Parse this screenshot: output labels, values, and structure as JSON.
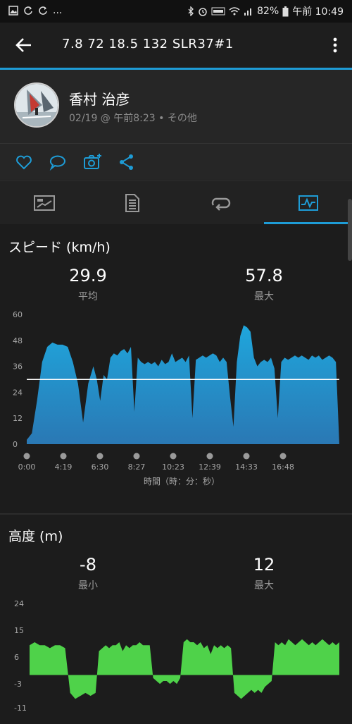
{
  "status_bar": {
    "battery": "82%",
    "time": "午前 10:49",
    "left_dots": "..."
  },
  "toolbar": {
    "title": "7.8  72  18.5  132  SLR37#1"
  },
  "profile": {
    "name": "香村 治彦",
    "meta": "02/19 @ 午前8:23 • その他"
  },
  "colors": {
    "accent": "#1e9cd6",
    "speed_fill": "#1fa6dc",
    "elevation_fill": "#4fd24a"
  },
  "speed": {
    "title": "スピード (km/h)",
    "avg_value": "29.9",
    "avg_label": "平均",
    "max_value": "57.8",
    "max_label": "最大",
    "x_axis_label": "時間（時：分：秒）"
  },
  "elevation": {
    "title": "高度 (m)",
    "min_value": "-8",
    "min_label": "最小",
    "max_value": "12",
    "max_label": "最大"
  },
  "chart_data": [
    {
      "type": "area",
      "title": "スピード (km/h)",
      "xlabel": "時間（時：分：秒）",
      "ylabel": "",
      "ylim": [
        0,
        60
      ],
      "yticks": [
        "0",
        "12",
        "24",
        "36",
        "48",
        "60"
      ],
      "xticks": [
        "0:00",
        "4:19",
        "6:30",
        "8:27",
        "10:23",
        "12:39",
        "14:33",
        "16:48"
      ],
      "reference_line": 29.9,
      "x": [
        0,
        0.3,
        0.6,
        0.9,
        1.2,
        1.5,
        1.8,
        2.1,
        2.4,
        2.7,
        3.0,
        3.3,
        3.6,
        3.9,
        4.1,
        4.3,
        4.5,
        4.7,
        4.9,
        5.1,
        5.3,
        5.5,
        5.7,
        5.9,
        6.1,
        6.3,
        6.5,
        6.7,
        6.9,
        7.1,
        7.3,
        7.5,
        7.7,
        7.9,
        8.1,
        8.3,
        8.5,
        8.7,
        8.9,
        9.1,
        9.3,
        9.5,
        9.7,
        9.9,
        10.1,
        10.3,
        10.5,
        10.7,
        10.9,
        11.1,
        11.3,
        11.5,
        11.7,
        11.9,
        12.1,
        12.3,
        12.5,
        12.7,
        12.9,
        13.1,
        13.3,
        13.5,
        13.7,
        13.9,
        14.1,
        14.3,
        14.5,
        14.7,
        14.9,
        15.1,
        15.3,
        15.5,
        15.7,
        15.9,
        16.1,
        16.3,
        16.5,
        16.7,
        16.9,
        17.1,
        17.3,
        17.5,
        17.7,
        17.9,
        18.1,
        18.3
      ],
      "series": [
        {
          "values": [
            2,
            5,
            20,
            38,
            45,
            47,
            46,
            46,
            45,
            38,
            28,
            10,
            28,
            36,
            30,
            20,
            32,
            30,
            40,
            42,
            41,
            43,
            44,
            42,
            45,
            15,
            40,
            38,
            37,
            38,
            37,
            38,
            36,
            39,
            37,
            38,
            42,
            38,
            39,
            40,
            38,
            41,
            12,
            39,
            40,
            41,
            40,
            41,
            42,
            41,
            38,
            40,
            38,
            22,
            8,
            38,
            50,
            55,
            54,
            52,
            40,
            36,
            38,
            39,
            38,
            40,
            35,
            12,
            38,
            40,
            39,
            40,
            41,
            40,
            41,
            40,
            39,
            41,
            40,
            41,
            39,
            40,
            41,
            40,
            38,
            0
          ]
        }
      ]
    },
    {
      "type": "area",
      "title": "高度 (m)",
      "ylabel": "",
      "ylim": [
        -11,
        24
      ],
      "yticks": [
        "24",
        "15",
        "6",
        "-3",
        "-11"
      ],
      "x": [
        0,
        0.3,
        0.6,
        0.9,
        1.2,
        1.5,
        1.8,
        2.1,
        2.4,
        2.7,
        3.0,
        3.3,
        3.6,
        3.9,
        4.1,
        4.3,
        4.5,
        4.7,
        4.9,
        5.1,
        5.3,
        5.5,
        5.7,
        5.9,
        6.1,
        6.3,
        6.5,
        6.7,
        6.9,
        7.1,
        7.3,
        7.5,
        7.7,
        7.9,
        8.1,
        8.3,
        8.5,
        8.7,
        8.9,
        9.1,
        9.3,
        9.5,
        9.7,
        9.9,
        10.1,
        10.3,
        10.5,
        10.7,
        10.9,
        11.1,
        11.3,
        11.5,
        11.7,
        11.9,
        12.1,
        12.3,
        12.5,
        12.7,
        12.9,
        13.1,
        13.3,
        13.5,
        13.7,
        13.9,
        14.1,
        14.3,
        14.5,
        14.7,
        14.9,
        15.1,
        15.3,
        15.5,
        15.7,
        15.9,
        16.1,
        16.3,
        16.5,
        16.7,
        16.9,
        17.1,
        17.3,
        17.5,
        17.7,
        17.9,
        18.1,
        18.3
      ],
      "series": [
        {
          "values": [
            10,
            11,
            10,
            10,
            9,
            10,
            10,
            9,
            -6,
            -8,
            -7,
            -6,
            -7,
            -6,
            8,
            9,
            10,
            9,
            10,
            10,
            11,
            8,
            10,
            9,
            10,
            10,
            11,
            10,
            10,
            10,
            -1,
            -2,
            -3,
            -2,
            -2,
            -3,
            -2,
            -3,
            -1,
            11,
            12,
            11,
            11,
            10,
            11,
            9,
            10,
            7,
            10,
            9,
            10,
            9,
            10,
            9,
            -6,
            -7,
            -8,
            -7,
            -6,
            -5,
            -6,
            -5,
            -6,
            -4,
            -3,
            -2,
            11,
            10,
            11,
            10,
            12,
            11,
            10,
            11,
            12,
            11,
            10,
            11,
            10,
            11,
            12,
            11,
            10,
            11,
            10,
            11
          ]
        }
      ]
    }
  ]
}
